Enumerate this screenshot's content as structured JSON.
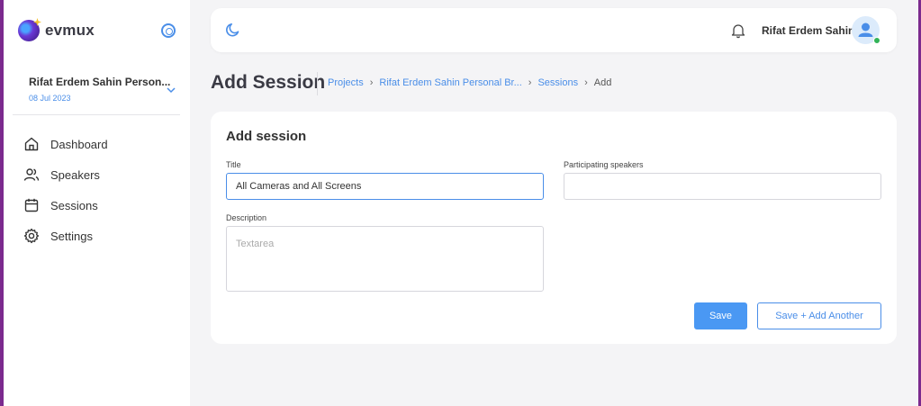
{
  "brand": {
    "name": "evmux"
  },
  "project": {
    "name": "Rifat Erdem Sahin Person...",
    "date": "08 Jul 2023"
  },
  "sidebar": {
    "items": [
      {
        "label": "Dashboard",
        "icon": "home-icon"
      },
      {
        "label": "Speakers",
        "icon": "users-icon"
      },
      {
        "label": "Sessions",
        "icon": "calendar-icon"
      },
      {
        "label": "Settings",
        "icon": "gear-icon"
      }
    ]
  },
  "header": {
    "user_name": "Rifat Erdem Sahin"
  },
  "page": {
    "title": "Add Session",
    "breadcrumb": [
      "Projects",
      "Rifat Erdem Sahin Personal Br...",
      "Sessions",
      "Add"
    ]
  },
  "form": {
    "heading": "Add session",
    "title_label": "Title",
    "title_value": "All Cameras and All Screens",
    "speakers_label": "Participating speakers",
    "speakers_value": "",
    "description_label": "Description",
    "description_placeholder": "Textarea",
    "save_label": "Save",
    "save_add_label": "Save + Add Another"
  },
  "colors": {
    "accent": "#4a8ee8",
    "primary_button": "#4a98f3",
    "frame": "#7b2a8e",
    "online": "#32b358"
  }
}
